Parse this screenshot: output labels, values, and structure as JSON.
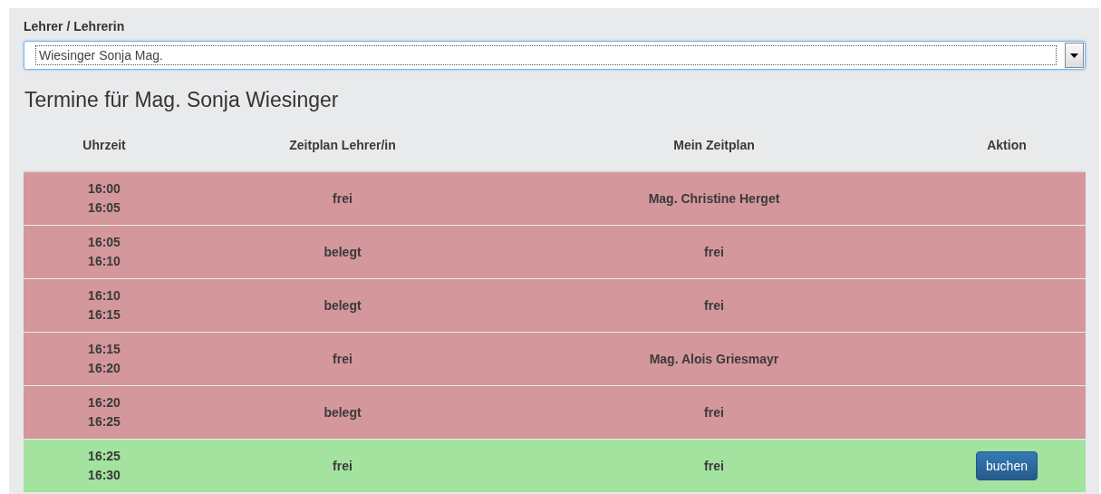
{
  "teacher_field": {
    "label": "Lehrer / Lehrerin",
    "value": "Wiesinger Sonja Mag."
  },
  "heading": "Termine für Mag. Sonja Wiesinger",
  "table": {
    "columns": [
      "Uhrzeit",
      "Zeitplan Lehrer/in",
      "Mein Zeitplan",
      "Aktion"
    ],
    "rows": [
      {
        "start": "16:00",
        "end": "16:05",
        "teacher_schedule": "frei",
        "my_schedule": "Mag. Christine Herget",
        "available": false
      },
      {
        "start": "16:05",
        "end": "16:10",
        "teacher_schedule": "belegt",
        "my_schedule": "frei",
        "available": false
      },
      {
        "start": "16:10",
        "end": "16:15",
        "teacher_schedule": "belegt",
        "my_schedule": "frei",
        "available": false
      },
      {
        "start": "16:15",
        "end": "16:20",
        "teacher_schedule": "frei",
        "my_schedule": "Mag. Alois Griesmayr",
        "available": false
      },
      {
        "start": "16:20",
        "end": "16:25",
        "teacher_schedule": "belegt",
        "my_schedule": "frei",
        "available": false
      },
      {
        "start": "16:25",
        "end": "16:30",
        "teacher_schedule": "frei",
        "my_schedule": "frei",
        "available": true,
        "action": "buchen"
      }
    ]
  }
}
